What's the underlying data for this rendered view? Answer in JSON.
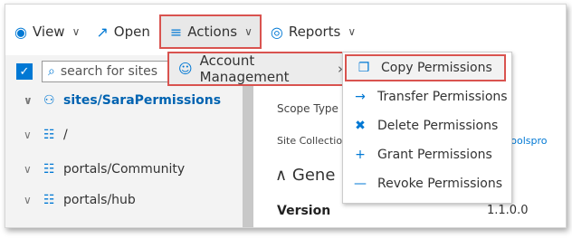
{
  "toolbar": {
    "view": "View",
    "open": "Open",
    "actions": "Actions",
    "reports": "Reports"
  },
  "search": {
    "placeholder": "search for sites"
  },
  "tree": [
    {
      "label": "sites/SaraPermissions"
    },
    {
      "label": "/"
    },
    {
      "label": "portals/Community"
    },
    {
      "label": "portals/hub"
    }
  ],
  "details": {
    "scope_type": "Scope Type",
    "site_collection": "Site Collectio",
    "site_link_fragment": "ningtoolspro",
    "section": "Gene",
    "version_label": "Version",
    "version_value": "1.1.0.0"
  },
  "actions_menu": {
    "item": "Account Management"
  },
  "submenu": [
    {
      "label": "Copy Permissions",
      "icon": "copy-icon"
    },
    {
      "label": "Transfer Permissions",
      "icon": "arrow-right-icon"
    },
    {
      "label": "Delete Permissions",
      "icon": "trash-icon"
    },
    {
      "label": "Grant Permissions",
      "icon": "plus-icon"
    },
    {
      "label": "Revoke Permissions",
      "icon": "minus-icon"
    }
  ],
  "colors": {
    "accent": "#0078d4",
    "highlight_border": "#d9534f"
  }
}
